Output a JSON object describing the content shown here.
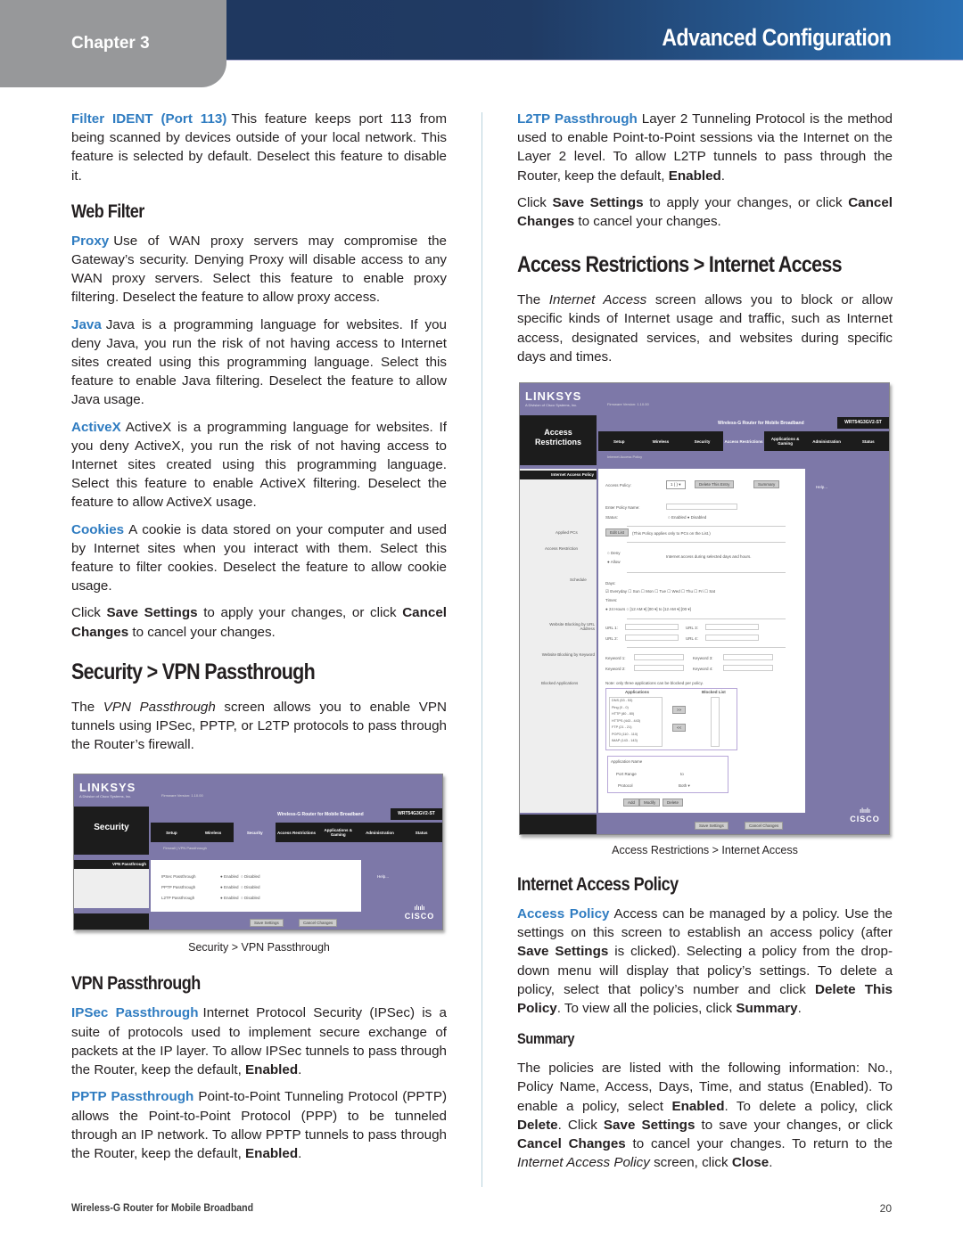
{
  "header": {
    "chapter": "Chapter 3",
    "section": "Advanced Configuration"
  },
  "left": {
    "filter_ident": {
      "term": "Filter IDENT (Port 113)",
      "text": "This feature keeps port 113 from being scanned by devices outside of your local network. This feature is selected by default. Deselect this feature to disable it."
    },
    "web_filter_heading": "Web Filter",
    "proxy": {
      "term": "Proxy",
      "text": "Use of WAN proxy servers may compromise the Gateway’s security. Denying Proxy will disable access to any WAN proxy servers. Select this feature to enable proxy filtering. Deselect the feature to allow proxy access."
    },
    "java": {
      "term": "Java",
      "text": "Java is a programming language for websites. If you deny Java, you run the risk of not having access to Internet sites created using this programming language. Select this feature to enable Java filtering. Deselect the feature to allow Java usage."
    },
    "activex": {
      "term": "ActiveX",
      "text": "ActiveX is a programming language for websites. If you deny ActiveX, you run the risk of not having access to Internet sites created using this programming language. Select this feature to enable ActiveX filtering. Deselect the feature to allow ActiveX usage."
    },
    "cookies": {
      "term": "Cookies",
      "text": "A cookie is data stored on your computer and used by Internet sites when you interact with them. Select this feature to filter cookies. Deselect the feature to allow cookie usage."
    },
    "save_note": {
      "pre": "Click ",
      "save": "Save Settings",
      "mid": " to apply your changes, or click ",
      "cancel": "Cancel Changes",
      "post": " to cancel your changes."
    },
    "vpn_section_heading": "Security > VPN Passthrough",
    "vpn_intro": {
      "pre": "The ",
      "ital": "VPN Passthrough",
      "post": " screen allows you to enable VPN tunnels using IPSec, PPTP, or L2TP protocols to pass through the Router’s firewall."
    },
    "vpn_screenshot": {
      "logo": "LINKSYS",
      "logo_sub": "A Division of Cisco Systems, Inc.",
      "firmware": "Firmware Version: 1.10.00",
      "product_name": "Wireless-G Router for Mobile Broadband",
      "model": "WRT54G3GV2-ST",
      "page_name": "Security",
      "tabs": [
        "Setup",
        "Wireless",
        "Security",
        "Access Restrictions",
        "Applications & Gaming",
        "Administration",
        "Status"
      ],
      "subnav": "Firewall  |  VPN Passthrough",
      "sidebar_item": "VPN Passthrough",
      "rows": [
        {
          "label": "IPSec Passthrough",
          "enabled": "Enabled",
          "disabled": "Disabled"
        },
        {
          "label": "PPTP Passthrough",
          "enabled": "Enabled",
          "disabled": "Disabled"
        },
        {
          "label": "L2TP Passthrough",
          "enabled": "Enabled",
          "disabled": "Disabled"
        }
      ],
      "help": "Help...",
      "save_button": "Save Settings",
      "cancel_button": "Cancel Changes",
      "cisco": "CISCO"
    },
    "vpn_caption": "Security > VPN Passthrough",
    "vpn_subheading": "VPN Passthrough",
    "ipsec": {
      "term": "IPSec Passthrough",
      "text": "Internet Protocol Security (IPSec) is a suite of protocols used to implement secure exchange of packets at the IP layer. To allow IPSec tunnels to pass through the Router, keep the default, ",
      "bold": "Enabled",
      "end": "."
    },
    "pptp": {
      "term": "PPTP Passthrough",
      "text": "Point-to-Point Tunneling Protocol (PPTP) allows the Point-to-Point Protocol (PPP) to be tunneled through an IP network. To allow PPTP tunnels to pass through the Router, keep the default, ",
      "bold": "Enabled",
      "end": "."
    }
  },
  "right": {
    "l2tp": {
      "term": "L2TP Passthrough",
      "text": "Layer 2 Tunneling Protocol is the method used to enable Point-to-Point sessions via the Internet on the Layer 2 level. To allow L2TP tunnels to pass through the Router, keep the default, ",
      "bold": "Enabled",
      "end": "."
    },
    "save_note": {
      "pre": "Click ",
      "save": "Save Settings",
      "mid": " to apply your changes, or click ",
      "cancel": "Cancel Changes",
      "post": " to cancel your changes."
    },
    "ar_heading": "Access Restrictions > Internet Access",
    "ar_intro": {
      "pre": "The ",
      "ital": "Internet Access",
      "post": " screen allows you to block or allow specific kinds of Internet usage and traffic, such as Internet access, designated services, and websites during specific days and times."
    },
    "ar_screenshot": {
      "logo": "LINKSYS",
      "logo_sub": "A Division of Cisco Systems, Inc.",
      "firmware": "Firmware Version: 1.10.00",
      "product_name": "Wireless-G Router for Mobile Broadband",
      "model": "WRT54G3GV2-ST",
      "page_name": "Access Restrictions",
      "tabs": [
        "Setup",
        "Wireless",
        "Security",
        "Access Restrictions",
        "Applications & Gaming",
        "Administration",
        "Status"
      ],
      "subnav": "Internet Access Policy",
      "sidebar_item": "Internet Access Policy",
      "access_policy_label": "Access Policy:",
      "access_policy_value": "1 ( )",
      "delete_button": "Delete This Entry",
      "summary_button": "Summary",
      "policy_name_label": "Enter Policy Name:",
      "status_label": "Status:",
      "status_enabled": "Enabled",
      "status_disabled": "Disabled",
      "applied_pcs_label": "Applied PCs",
      "edit_list_button": "Edit List",
      "applied_pcs_note": "(This Policy applies only to PCs on the List.)",
      "access_restriction_label": "Access Restriction",
      "deny": "Deny",
      "allow": "Allow",
      "restriction_note": "Internet access during selected days and hours.",
      "schedule_label": "Schedule",
      "days_label": "Days:",
      "days": [
        "Everyday",
        "Sun",
        "Mon",
        "Tue",
        "Wed",
        "Thu",
        "Fri",
        "Sat"
      ],
      "times_label": "Times:",
      "hours24": "24 Hours",
      "time_from_h": "12 AM",
      "time_from_m": "00",
      "to": "to",
      "time_to_h": "12 AM",
      "time_to_m": "00",
      "url_block_label": "Website Blocking by URL Address",
      "urls": [
        "URL 1:",
        "URL 3:",
        "URL 2:",
        "URL 4:"
      ],
      "keyword_block_label": "Website Blocking by Keyword",
      "keywords": [
        "Keyword 1:",
        "Keyword 3:",
        "Keyword 2:",
        "Keyword 4:"
      ],
      "blocked_apps_label": "Blocked Applications",
      "blocked_note": "Note: only three applications can be blocked per policy.",
      "applications_header": "Applications",
      "blocked_list_header": "Blocked List",
      "applications": [
        "DNS (53 - 53)",
        "Ping (0 - 0)",
        "HTTP (80 - 80)",
        "HTTPS (443 - 443)",
        "FTP (21 - 21)",
        "POP3 (110 - 110)",
        "IMAP (143 - 143)"
      ],
      "move_right": ">>",
      "move_left": "<<",
      "app_name_label": "Application Name",
      "port_range_label": "Port Range",
      "port_to": "to",
      "protocol_label": "Protocol",
      "protocol_value": "Both",
      "add_button": "Add",
      "modify_button": "Modify",
      "delete_app_button": "Delete",
      "help": "Help...",
      "save_button": "Save Settings",
      "cancel_button": "Cancel Changes",
      "cisco": "CISCO"
    },
    "ar_caption": "Access Restrictions > Internet Access",
    "iap_heading": "Internet Access Policy",
    "access_policy": {
      "term": "Access Policy",
      "t1": "Access can be managed by a policy. Use the settings on this screen to establish an access policy (after ",
      "b1": "Save Settings",
      "t2": " is clicked). Selecting a policy from the drop-down menu will display that policy’s settings. To delete a policy, select that policy’s number and click ",
      "b2": "Delete This Policy",
      "t3": ". To view all the policies, click ",
      "b3": "Summary",
      "t4": "."
    },
    "summary_heading": "Summary",
    "summary": {
      "t1": "The policies are listed with the following information: No., Policy Name, Access, Days, Time, and status (Enabled). To enable a policy, select ",
      "b1": "Enabled",
      "t2": ". To delete a policy, click ",
      "b2": "Delete",
      "t3": ". Click ",
      "b3": "Save Settings",
      "t4": " to save your changes, or click ",
      "b4": "Cancel Changes",
      "t5": " to cancel your changes. To return to the ",
      "i1": "Internet Access Policy",
      "t6": " screen, click ",
      "b5": "Close",
      "t7": "."
    }
  },
  "footer": {
    "product": "Wireless-G Router for Mobile Broadband",
    "page_number": "20"
  },
  "colors": {
    "header_dark": "#1e355c",
    "header_light": "#2a70b4",
    "chapter_tab": "#97989a",
    "term_blue": "#2f7cc1",
    "screenshot_purple": "#7d78a8"
  }
}
